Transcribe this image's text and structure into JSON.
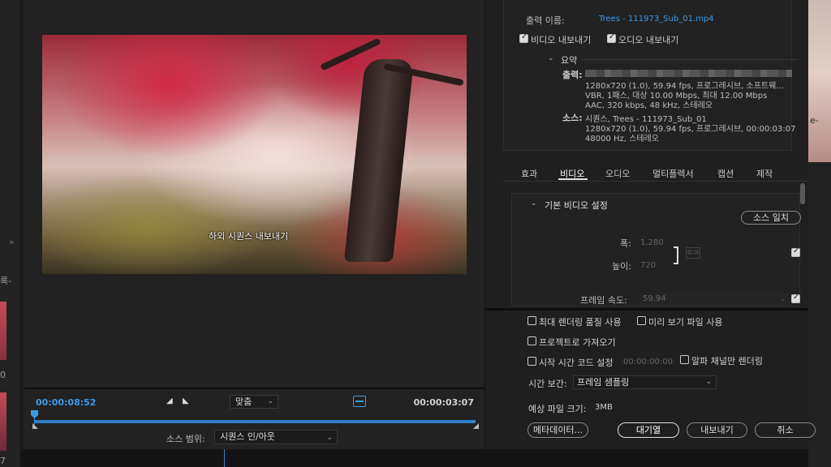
{
  "background": {
    "left_label": "록-",
    "left_numbers": [
      "0",
      "7"
    ],
    "right_label": "e-",
    "collapse_glyph": "»"
  },
  "preview": {
    "subtitle": "하외 시퀀스 내보내기",
    "current_timecode": "00:00:08:52",
    "duration_timecode": "00:00:03:07",
    "mark_in_glyph": "◢",
    "mark_out_glyph": "◣",
    "fit_label": "맞춤",
    "source_range_label": "소스 범위:",
    "source_range_value": "시퀀스 인/아웃",
    "accent_color": "#3b9ae8"
  },
  "export": {
    "output_name_label": "출력 이름:",
    "output_name_value": "Trees - 111973_Sub_01.mp4",
    "export_video_label": "비디오 내보내기",
    "export_video_checked": true,
    "export_audio_label": "오디오 내보내기",
    "export_audio_checked": true
  },
  "summary": {
    "title": "요약",
    "output_key": "출력:",
    "output_lines": [
      "1280x720 (1.0), 59.94 fps, 프로그레시브, 소프트웨...",
      "VBR, 1패스, 대상 10.00 Mbps, 최대 12.00 Mbps",
      "AAC, 320 kbps, 48 kHz, 스테레오"
    ],
    "source_key": "소스:",
    "source_lines": [
      "시퀀스, Trees - 111973_Sub_01",
      "1280x720 (1.0), 59.94 fps, 프로그레시브, 00:00:03:07",
      "48000 Hz, 스테레오"
    ]
  },
  "tabs": [
    "효과",
    "비디오",
    "오디오",
    "멀티플렉서",
    "캡션",
    "제작"
  ],
  "active_tab": "비디오",
  "video_settings": {
    "section_title": "기본 비디오 설정",
    "match_source_button": "소스 일치",
    "width_label": "폭:",
    "width_value": "1,280",
    "height_label": "높이:",
    "height_value": "720",
    "frame_rate_label": "프레임 속도:",
    "frame_rate_value": "59.94",
    "link_glyph": "⊂⊃"
  },
  "options": {
    "max_render_quality": "최대 렌더링 품질 사용",
    "use_previews": "미리 보기 파일 사용",
    "import_into_project": "프로젝트로 가져오기",
    "set_start_timecode": "시작 시간 코드 설정",
    "start_timecode_value": "00:00:00:00",
    "render_alpha_only": "알파 채널만 렌더링",
    "time_interpolation_label": "시간 보간:",
    "time_interpolation_value": "프레임 샘플링",
    "estimated_size_label": "예상 파일 크기:",
    "estimated_size_value": "3MB"
  },
  "buttons": {
    "metadata": "메타데이터...",
    "queue": "대기열",
    "export": "내보내기",
    "cancel": "취소"
  }
}
